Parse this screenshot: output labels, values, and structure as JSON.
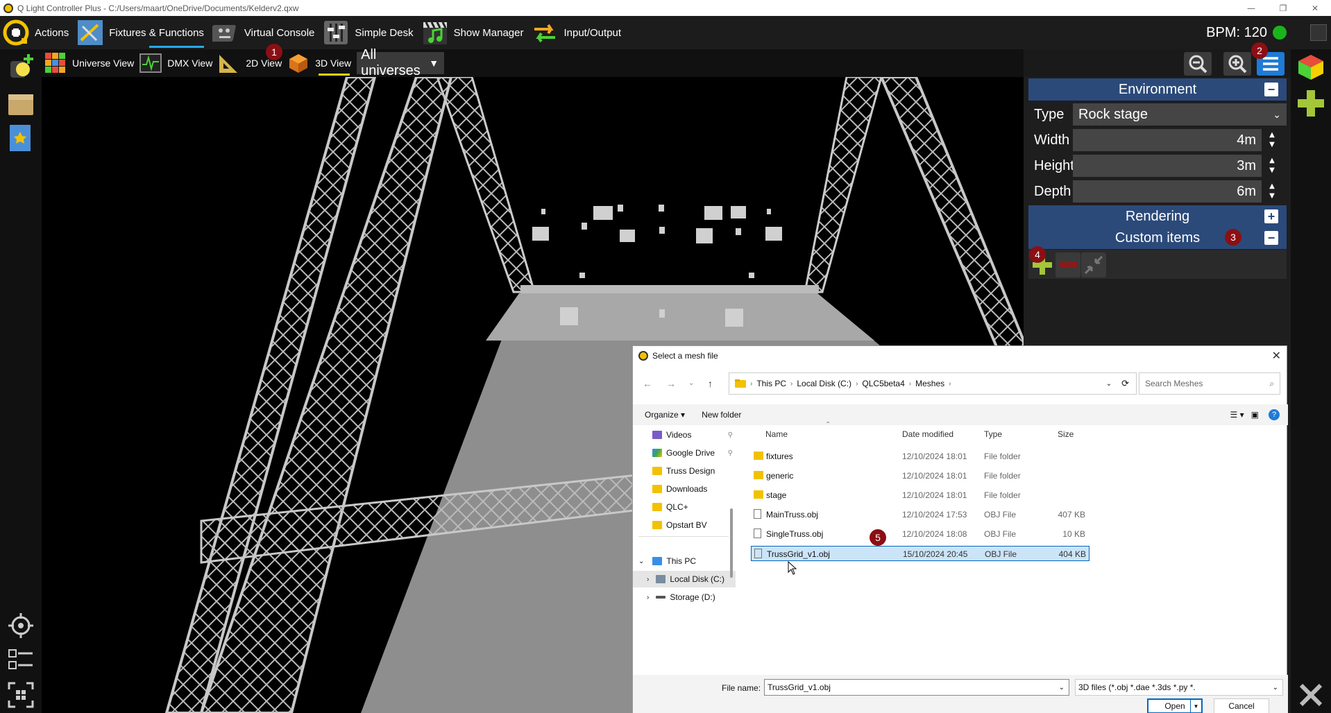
{
  "window": {
    "title": "Q Light Controller Plus - C:/Users/maart/OneDrive/Documents/Kelderv2.qxw"
  },
  "main_toolbar": {
    "tabs": [
      {
        "label": "Actions",
        "icon": "qlc-logo-icon"
      },
      {
        "label": "Fixtures & Functions",
        "icon": "fixtures-icon"
      },
      {
        "label": "Virtual Console",
        "icon": "virtual-console-icon"
      },
      {
        "label": "Simple Desk",
        "icon": "sliders-icon"
      },
      {
        "label": "Show Manager",
        "icon": "music-clapper-icon"
      },
      {
        "label": "Input/Output",
        "icon": "arrows-io-icon"
      }
    ],
    "bpm_label": "BPM: 120"
  },
  "sub_toolbar": {
    "views": [
      {
        "label": "Universe View"
      },
      {
        "label": "DMX View"
      },
      {
        "label": "2D View"
      },
      {
        "label": "3D View"
      }
    ],
    "universe": "All universes"
  },
  "environment": {
    "header": "Environment",
    "type_label": "Type",
    "type_value": "Rock stage",
    "width_label": "Width",
    "width_value": "4m",
    "height_label": "Height",
    "height_value": "3m",
    "depth_label": "Depth",
    "depth_value": "6m",
    "rendering_header": "Rendering",
    "custom_items_header": "Custom items"
  },
  "badges": [
    "1",
    "2",
    "3",
    "4",
    "5"
  ],
  "dialog": {
    "title": "Select a mesh file",
    "breadcrumb": [
      "This PC",
      "Local Disk (C:)",
      "QLC5beta4",
      "Meshes"
    ],
    "search_placeholder": "Search Meshes",
    "organize": "Organize",
    "new_folder": "New folder",
    "nav": [
      {
        "label": "Videos"
      },
      {
        "label": "Google Drive"
      },
      {
        "label": "Truss Design"
      },
      {
        "label": "Downloads"
      },
      {
        "label": "QLC+"
      },
      {
        "label": "Opstart BV"
      },
      {
        "label": "This PC"
      },
      {
        "label": "Local Disk (C:)"
      },
      {
        "label": "Storage (D:)"
      }
    ],
    "columns": [
      "Name",
      "Date modified",
      "Type",
      "Size"
    ],
    "rows": [
      {
        "name": "fixtures",
        "date": "12/10/2024 18:01",
        "type": "File folder",
        "size": ""
      },
      {
        "name": "generic",
        "date": "12/10/2024 18:01",
        "type": "File folder",
        "size": ""
      },
      {
        "name": "stage",
        "date": "12/10/2024 18:01",
        "type": "File folder",
        "size": ""
      },
      {
        "name": "MainTruss.obj",
        "date": "12/10/2024 17:53",
        "type": "OBJ File",
        "size": "407 KB"
      },
      {
        "name": "SingleTruss.obj",
        "date": "12/10/2024 18:08",
        "type": "OBJ File",
        "size": "10 KB"
      },
      {
        "name": "TrussGrid_v1.obj",
        "date": "15/10/2024 20:45",
        "type": "OBJ File",
        "size": "404 KB"
      }
    ],
    "file_name_label": "File name:",
    "file_name_value": "TrussGrid_v1.obj",
    "file_type": "3D files (*.obj *.dae *.3ds *.py *.",
    "open": "Open",
    "cancel": "Cancel"
  },
  "colors": {
    "accent_blue": "#29a8ff",
    "section_header": "#2b4a7a",
    "badge_red": "#8b0f14",
    "active_view_underline": "#f5d000"
  }
}
